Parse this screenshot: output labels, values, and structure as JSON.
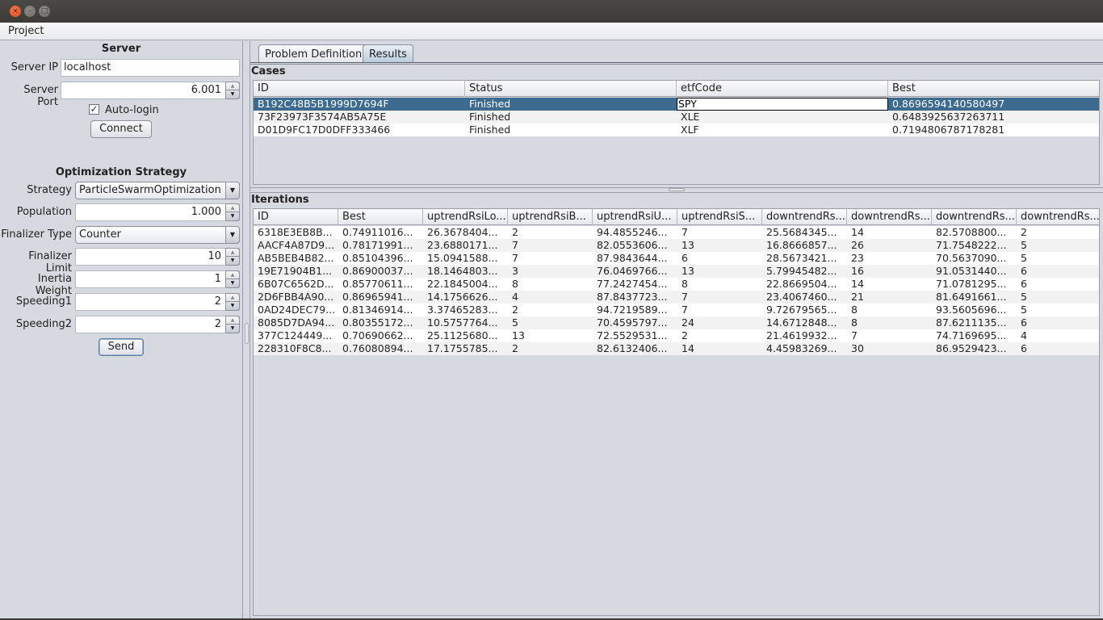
{
  "window": {
    "close_glyph": "×"
  },
  "menu": {
    "items": [
      "Project"
    ]
  },
  "server": {
    "title": "Server",
    "ip_label": "Server IP",
    "ip_value": "localhost",
    "port_label": "Server Port",
    "port_value": "6.001",
    "autologin_label": "Auto-login",
    "autologin_checked": true,
    "checkmark": "✓",
    "connect_label": "Connect"
  },
  "strategy": {
    "title": "Optimization Strategy",
    "strategy_label": "Strategy",
    "strategy_value": "ParticleSwarmOptimization",
    "population_label": "Population",
    "population_value": "1.000",
    "finalizer_type_label": "Finalizer Type",
    "finalizer_type_value": "Counter",
    "finalizer_limit_label": "Finalizer Limit",
    "finalizer_limit_value": "10",
    "inertia_label": "Inertia Weight",
    "inertia_value": "1",
    "speeding1_label": "Speeding1",
    "speeding1_value": "2",
    "speeding2_label": "Speeding2",
    "speeding2_value": "2",
    "send_label": "Send",
    "arrow_down": "▼",
    "spin_up": "▲",
    "spin_down": "▼"
  },
  "tabs": [
    {
      "label": "Problem Definition",
      "active": false
    },
    {
      "label": "Results",
      "active": true
    }
  ],
  "cases": {
    "title": "Cases",
    "columns": [
      "ID",
      "Status",
      "etfCode",
      "Best"
    ],
    "rows": [
      [
        "B192C48B5B1999D7694F",
        "Finished",
        "SPY",
        "0.8696594140580497"
      ],
      [
        "73F23973F3574AB5A75E",
        "Finished",
        "XLE",
        "0.6483925637263711"
      ],
      [
        "D01D9FC17D0DFF333466",
        "Finished",
        "XLF",
        "0.7194806787178281"
      ]
    ],
    "selected_row": 0
  },
  "iterations": {
    "title": "Iterations",
    "columns": [
      "ID",
      "Best",
      "uptrendRsiLo...",
      "uptrendRsiB...",
      "uptrendRsiU...",
      "uptrendRsiS...",
      "downtrendRs...",
      "downtrendRs...",
      "downtrendRs...",
      "downtrendRs..."
    ],
    "rows": [
      [
        "6318E3EB8B...",
        "0.74911016...",
        "26.3678404...",
        "2",
        "94.4855246...",
        "7",
        "25.5684345...",
        "14",
        "82.5708800...",
        "2"
      ],
      [
        "AACF4A87D9...",
        "0.78171991...",
        "23.6880171...",
        "7",
        "82.0553606...",
        "13",
        "16.8666857...",
        "26",
        "71.7548222...",
        "5"
      ],
      [
        "AB5BEB4B82...",
        "0.85104396...",
        "15.0941588...",
        "7",
        "87.9843644...",
        "6",
        "28.5673421...",
        "23",
        "70.5637090...",
        "5"
      ],
      [
        "19E71904B1...",
        "0.86900037...",
        "18.1464803...",
        "3",
        "76.0469766...",
        "13",
        "5.79945482...",
        "16",
        "91.0531440...",
        "6"
      ],
      [
        "6B07C6562D...",
        "0.85770611...",
        "22.1845004...",
        "8",
        "77.2427454...",
        "8",
        "22.8669504...",
        "14",
        "71.0781295...",
        "6"
      ],
      [
        "2D6FBB4A90...",
        "0.86965941...",
        "14.1756626...",
        "4",
        "87.8437723...",
        "7",
        "23.4067460...",
        "21",
        "81.6491661...",
        "5"
      ],
      [
        "0AD24DEC79...",
        "0.81346914...",
        "3.37465283...",
        "2",
        "94.7219589...",
        "7",
        "9.72679565...",
        "8",
        "93.5605696...",
        "5"
      ],
      [
        "8085D7DA94...",
        "0.80355172...",
        "10.5757764...",
        "5",
        "70.4595797...",
        "24",
        "14.6712848...",
        "8",
        "87.6211135...",
        "6"
      ],
      [
        "377C124449...",
        "0.70690662...",
        "25.1125680...",
        "13",
        "72.5529531...",
        "2",
        "21.4619932...",
        "7",
        "74.7169695...",
        "4"
      ],
      [
        "228310F8C8...",
        "0.76080894...",
        "17.1755785...",
        "2",
        "82.6132406...",
        "14",
        "4.45983269...",
        "30",
        "86.9529423...",
        "6"
      ]
    ]
  }
}
